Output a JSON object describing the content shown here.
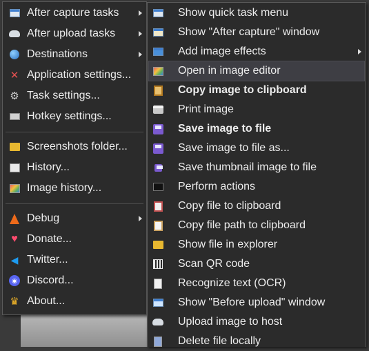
{
  "main_menu": {
    "items": [
      {
        "label": "After capture tasks",
        "icon": "window-capture-icon",
        "submenu": true
      },
      {
        "label": "After upload tasks",
        "icon": "cloud-upload-icon",
        "submenu": true
      },
      {
        "label": "Destinations",
        "icon": "globe-icon",
        "submenu": true
      },
      {
        "label": "Application settings...",
        "icon": "tools-icon"
      },
      {
        "label": "Task settings...",
        "icon": "gear-icon"
      },
      {
        "label": "Hotkey settings...",
        "icon": "keyboard-icon"
      },
      {
        "label": "Screenshots folder...",
        "icon": "folder-icon"
      },
      {
        "label": "History...",
        "icon": "history-list-icon"
      },
      {
        "label": "Image history...",
        "icon": "image-history-icon"
      },
      {
        "label": "Debug",
        "icon": "traffic-cone-icon",
        "submenu": true
      },
      {
        "label": "Donate...",
        "icon": "heart-icon"
      },
      {
        "label": "Twitter...",
        "icon": "twitter-bird-icon"
      },
      {
        "label": "Discord...",
        "icon": "discord-icon"
      },
      {
        "label": "About...",
        "icon": "crown-icon"
      }
    ]
  },
  "sub_menu": {
    "items": [
      {
        "label": "Show quick task menu",
        "icon": "window-icon"
      },
      {
        "label": "Show \"After capture\" window",
        "icon": "window-list-icon"
      },
      {
        "label": "Add image effects",
        "icon": "image-effects-icon",
        "submenu": true
      },
      {
        "label": "Open in image editor",
        "icon": "image-editor-icon",
        "highlighted": true
      },
      {
        "label": "Copy image to clipboard",
        "icon": "clipboard-image-icon",
        "bold": true
      },
      {
        "label": "Print image",
        "icon": "printer-icon"
      },
      {
        "label": "Save image to file",
        "icon": "floppy-disk-icon",
        "bold": true
      },
      {
        "label": "Save image to file as...",
        "icon": "floppy-disk-as-icon"
      },
      {
        "label": "Save thumbnail image to file",
        "icon": "floppy-disk-small-icon"
      },
      {
        "label": "Perform actions",
        "icon": "terminal-icon"
      },
      {
        "label": "Copy file to clipboard",
        "icon": "clipboard-file-icon"
      },
      {
        "label": "Copy file path to clipboard",
        "icon": "clipboard-path-icon"
      },
      {
        "label": "Show file in explorer",
        "icon": "folder-open-icon"
      },
      {
        "label": "Scan QR code",
        "icon": "qr-code-icon"
      },
      {
        "label": "Recognize text (OCR)",
        "icon": "ocr-document-icon"
      },
      {
        "label": "Show \"Before upload\" window",
        "icon": "window-upload-icon"
      },
      {
        "label": "Upload image to host",
        "icon": "cloud-upload-icon"
      },
      {
        "label": "Delete file locally",
        "icon": "delete-file-icon"
      }
    ]
  },
  "colors": {
    "menu_background": "#2b2b2b",
    "highlight": "#3e3e44",
    "text": "#ececec"
  }
}
